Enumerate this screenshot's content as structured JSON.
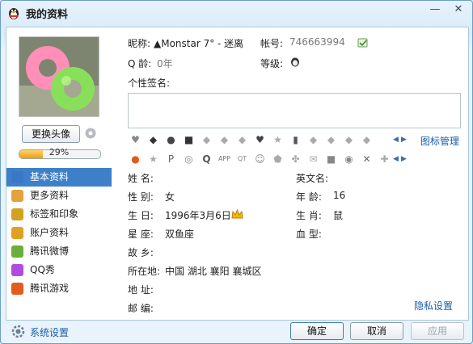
{
  "window": {
    "title": "我的资料",
    "minimize": "—",
    "close": "✕"
  },
  "left": {
    "change_avatar": "更换头像",
    "progress_text": "29%",
    "progress_value": 0.29,
    "nav": [
      {
        "label": "基本资料",
        "name": "nav-item-basic-info",
        "icon": "profile-card-icon",
        "color": "#3a77c9"
      },
      {
        "label": "更多资料",
        "name": "nav-item-more-info",
        "icon": "document-icon",
        "color": "#e3a23a"
      },
      {
        "label": "标签和印象",
        "name": "nav-item-tags",
        "icon": "tag-icon",
        "color": "#d4a021"
      },
      {
        "label": "账户资料",
        "name": "nav-item-account",
        "icon": "coin-icon",
        "color": "#e0a020"
      },
      {
        "label": "腾讯微博",
        "name": "nav-item-weibo",
        "icon": "weibo-icon",
        "color": "#6cae3a"
      },
      {
        "label": "QQ秀",
        "name": "nav-item-qqshow",
        "icon": "qqshow-icon",
        "color": "#b04ce0"
      },
      {
        "label": "腾讯游戏",
        "name": "nav-item-games",
        "icon": "games-icon",
        "color": "#e35b1e"
      }
    ]
  },
  "profile": {
    "nickname_label": "昵称:",
    "nickname_value": "▲Monstar 7° - 迷离",
    "account_label": "帐号:",
    "account_value": "746663994",
    "qage_label": "Q 龄:",
    "qage_value": "0年",
    "level_label": "等级:",
    "signature_label": "个性签名:",
    "manage_icons": "图标管理"
  },
  "details": {
    "name_label": "姓    名:",
    "english_label": "英文名:",
    "gender_label": "性    别:",
    "gender_value": "女",
    "age_label": "年    龄:",
    "age_value": "16",
    "birthday_label": "生    日:",
    "birthday_value": "1996年3月6日",
    "zodiac_label": "生    肖:",
    "zodiac_value": "鼠",
    "star_label": "星    座:",
    "star_value": "双鱼座",
    "blood_label": "血    型:",
    "hometown_label": "故    乡:",
    "location_label": "所在地:",
    "location_value": "中国  湖北  襄阳  襄城区",
    "address_label": "地    址:",
    "postcode_label": "邮    编:",
    "privacy": "隐私设置"
  },
  "footer": {
    "settings": "系统设置",
    "ok": "确定",
    "cancel": "取消",
    "apply": "应用"
  }
}
